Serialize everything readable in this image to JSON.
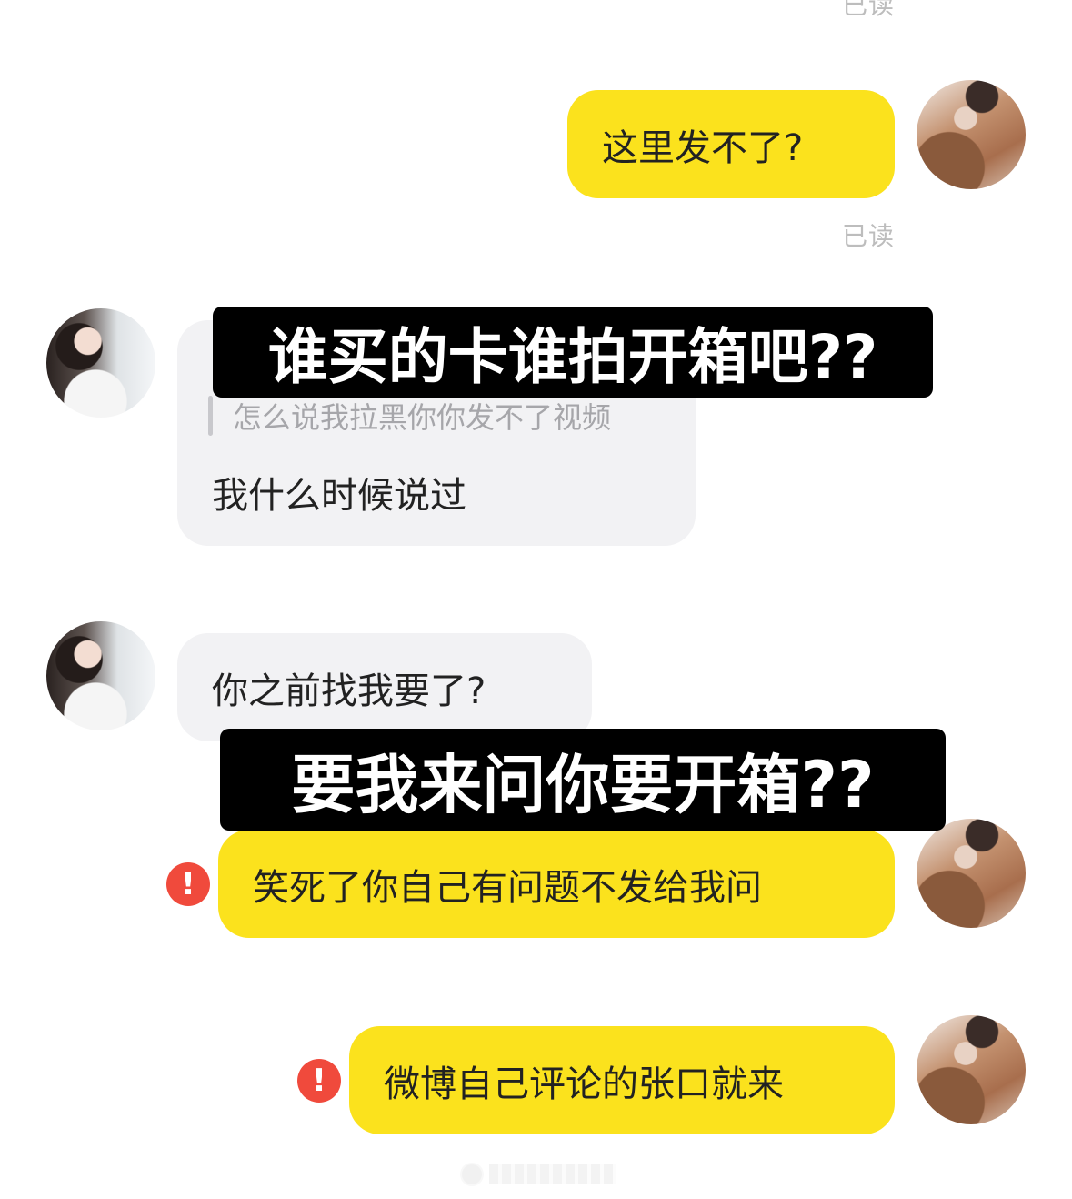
{
  "read_label": "已读",
  "messages": {
    "m1": {
      "text": "这里发不了?"
    },
    "m2": {
      "quote": "怎么说我拉黑你你发不了视频",
      "text": "我什么时候说过"
    },
    "m3": {
      "text": "你之前找我要了?"
    },
    "m4": {
      "text": "笑死了你自己有问题不发给我问"
    },
    "m5": {
      "text": "微博自己评论的张口就来"
    }
  },
  "captions": {
    "c1": "谁买的卡谁拍开箱吧??",
    "c2": "要我来问你要开箱??"
  },
  "error_icon": "!",
  "colors": {
    "my_bubble": "#fbe21d",
    "friend_bubble": "#f2f2f4",
    "read_status": "#bdbdbd",
    "error": "#f04a3c",
    "caption_bg": "#000000"
  }
}
